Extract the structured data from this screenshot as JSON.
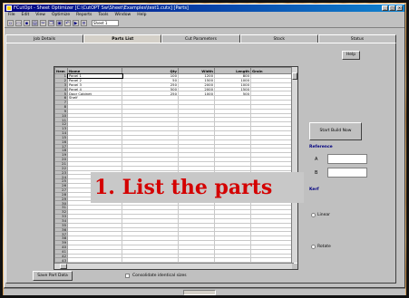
{
  "window": {
    "title": "FCutOpt - Sheet Optimizer  [C:\\CutOPT Sw\\Sheet\\Examples\\test1.cutx]   [Parts]",
    "controls": [
      "_",
      "□",
      "×"
    ]
  },
  "menu": [
    "File",
    "Edit",
    "View",
    "Optimize",
    "Reports",
    "Tools",
    "Window",
    "Help"
  ],
  "toolbar": {
    "icons": [
      "new-icon",
      "open-icon",
      "save-icon",
      "print-icon",
      "cut-icon",
      "copy-icon",
      "paste-icon",
      "undo-icon",
      "optimize-icon",
      "report-icon"
    ],
    "combo_value": "Sheet 1"
  },
  "tabs": [
    {
      "label": "Job Details",
      "active": false
    },
    {
      "label": "Parts List",
      "active": true
    },
    {
      "label": "Cut Parameters",
      "active": false
    },
    {
      "label": "Stock",
      "active": false
    },
    {
      "label": "Status",
      "active": false
    }
  ],
  "help_button": "Help",
  "grid": {
    "columns": [
      "Item",
      "Name",
      "Qty",
      "Width",
      "Length",
      "Grain"
    ],
    "rows": [
      {
        "num": "1",
        "name": "Panel 1",
        "qty": "100",
        "width": "1200",
        "length": "800",
        "grain": "",
        "selected": true
      },
      {
        "num": "2",
        "name": "Panel 2",
        "qty": "50",
        "width": "1500",
        "length": "1000",
        "grain": ""
      },
      {
        "num": "3",
        "name": "Panel 3",
        "qty": "250",
        "width": "2000",
        "length": "1000",
        "grain": ""
      },
      {
        "num": "4",
        "name": "Panel 4",
        "qty": "500",
        "width": "2000",
        "length": "1500",
        "grain": ""
      },
      {
        "num": "5",
        "name": "Door Cabinet",
        "qty": "250",
        "width": "1000",
        "length": "500",
        "grain": ""
      },
      {
        "num": "6",
        "name": "Shelf",
        "qty": "",
        "width": "",
        "length": "",
        "grain": ""
      }
    ],
    "empty_rows": 48,
    "first_empty_row": 7
  },
  "right_panel": {
    "start_button": "Start Build Now",
    "reference_label": "Reference",
    "field_a_label": "A",
    "field_b_label": "B",
    "field_a_value": "",
    "field_b_value": "",
    "kerf_label": "Kerf",
    "radio_1": "Linear",
    "radio_2": "Rotate"
  },
  "bottom": {
    "button": "Save Part Data",
    "checkbox_label": "Consolidate identical sizes"
  },
  "overlay_caption": "1. List the parts"
}
